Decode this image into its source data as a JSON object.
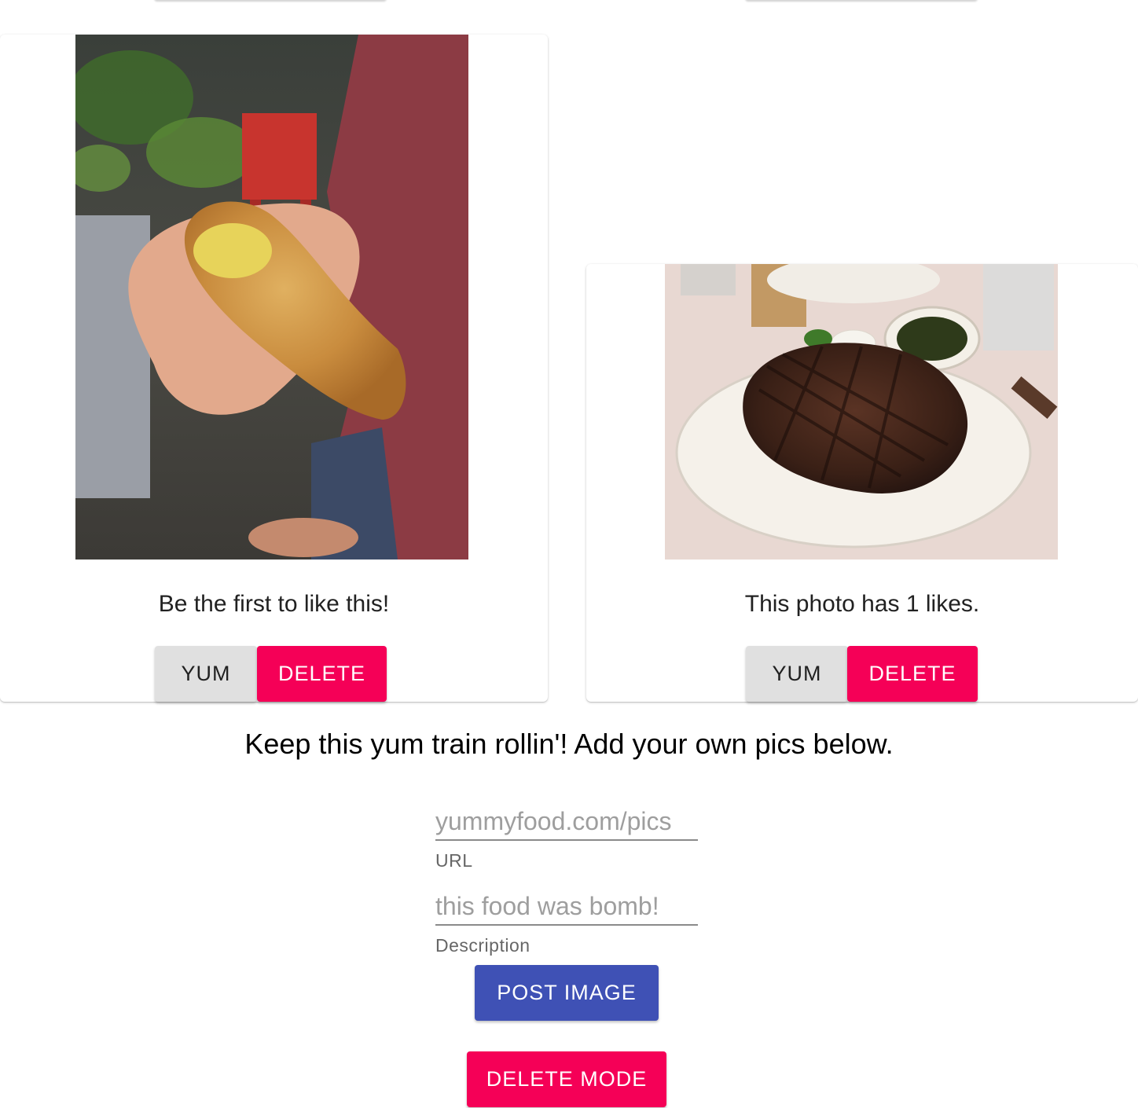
{
  "cards": [
    {
      "photo_alt": "fried plantain fritter in hand",
      "caption": "Be the first to like this!",
      "yum_label": "YUM",
      "delete_label": "DELETE"
    },
    {
      "photo_alt": "grilled steak on a plate",
      "caption": "This photo has 1 likes.",
      "yum_label": "YUM",
      "delete_label": "DELETE"
    }
  ],
  "form": {
    "headline": "Keep this yum train rollin'! Add your own pics below.",
    "url_placeholder": "yummyfood.com/pics",
    "url_helper": "URL",
    "description_placeholder": "this food was bomb!",
    "description_helper": "Description",
    "post_label": "POST IMAGE",
    "delete_mode_label": "DELETE MODE"
  },
  "colors": {
    "primary": "#3f51b5",
    "secondary": "#f50057",
    "default_button": "#e0e0e0"
  }
}
